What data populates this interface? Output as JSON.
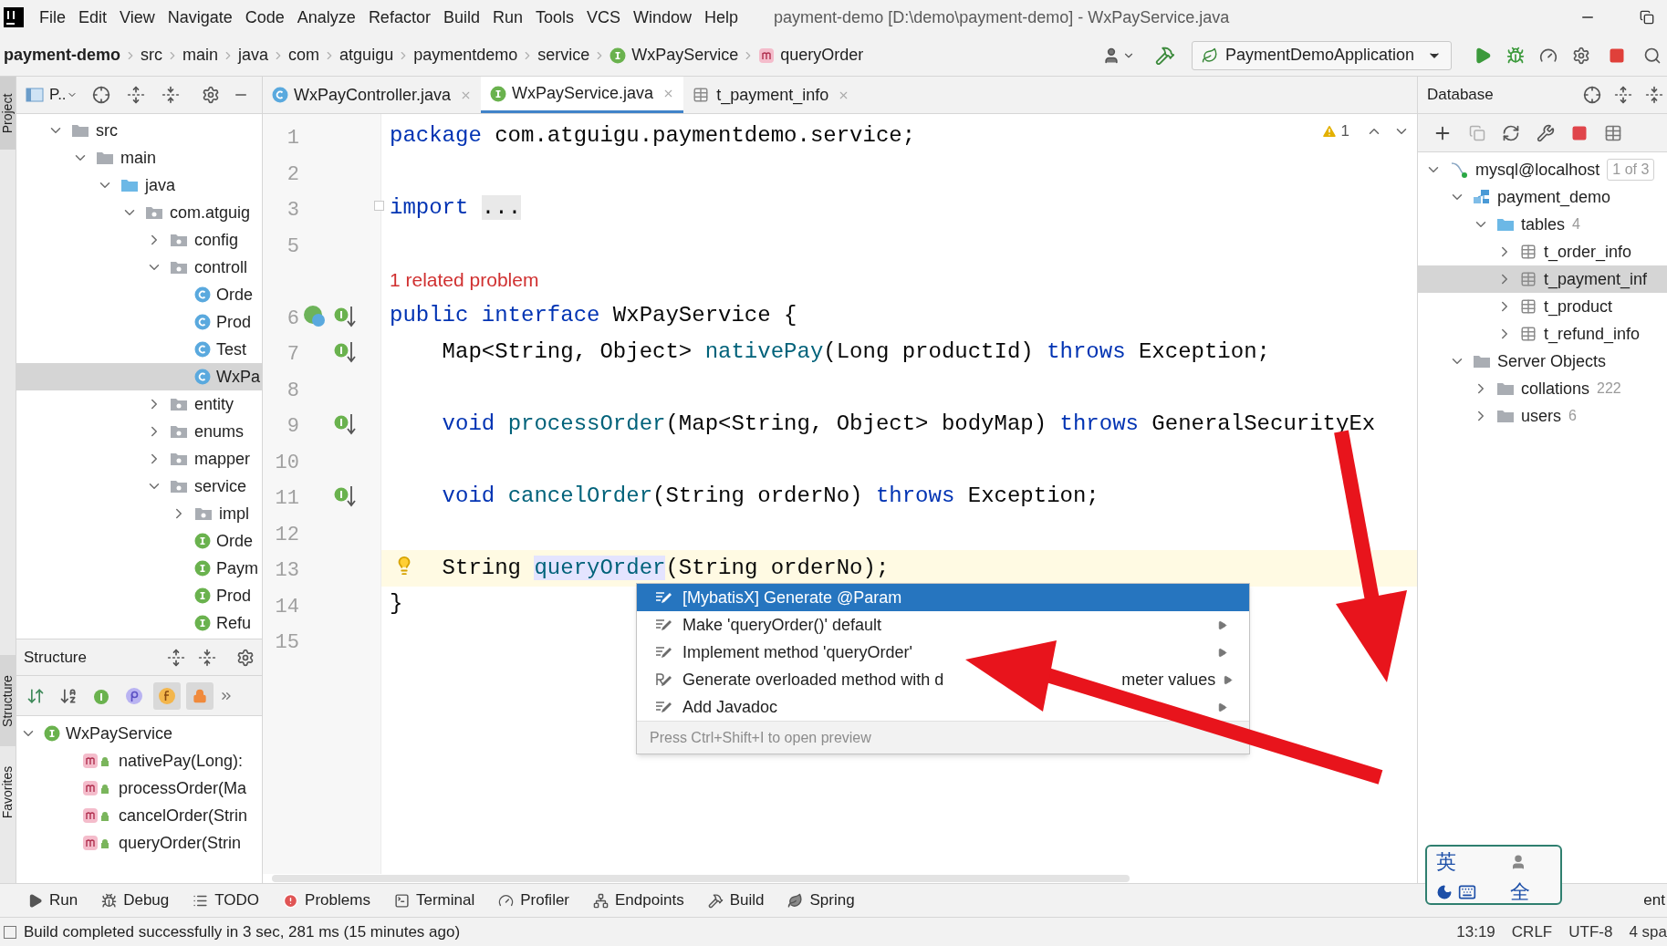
{
  "menu_bar": {
    "items": [
      "File",
      "Edit",
      "View",
      "Navigate",
      "Code",
      "Analyze",
      "Refactor",
      "Build",
      "Run",
      "Tools",
      "VCS",
      "Window",
      "Help"
    ],
    "title": "payment-demo [D:\\demo\\payment-demo] - WxPayService.java"
  },
  "breadcrumbs": [
    {
      "label": "payment-demo",
      "kind": "project"
    },
    {
      "label": "src",
      "kind": "dir"
    },
    {
      "label": "main",
      "kind": "dir"
    },
    {
      "label": "java",
      "kind": "dir"
    },
    {
      "label": "com",
      "kind": "dir"
    },
    {
      "label": "atguigu",
      "kind": "dir"
    },
    {
      "label": "paymentdemo",
      "kind": "dir"
    },
    {
      "label": "service",
      "kind": "dir"
    },
    {
      "label": "WxPayService",
      "kind": "interface"
    },
    {
      "label": "queryOrder",
      "kind": "method"
    }
  ],
  "run_config": "PaymentDemoApplication",
  "side_strip": {
    "top": [
      "Project"
    ],
    "bottom": [
      "Structure",
      "Favorites"
    ]
  },
  "project_panel": {
    "title": "P..",
    "tree": [
      {
        "label": "src",
        "kind": "folder",
        "expanded": true,
        "selected": false,
        "children": [
          {
            "label": "main",
            "kind": "folder",
            "expanded": true,
            "selected": false,
            "children": [
              {
                "label": "java",
                "kind": "source-folder",
                "expanded": true,
                "selected": false,
                "children": [
                  {
                    "label": "com.atguig",
                    "kind": "package",
                    "expanded": true,
                    "selected": false,
                    "children": [
                      {
                        "label": "config",
                        "kind": "package",
                        "expanded": false,
                        "selected": false
                      },
                      {
                        "label": "controll",
                        "kind": "package",
                        "expanded": true,
                        "selected": false,
                        "children": [
                          {
                            "label": "Orde",
                            "kind": "class",
                            "selected": false
                          },
                          {
                            "label": "Prod",
                            "kind": "class",
                            "selected": false
                          },
                          {
                            "label": "Test",
                            "kind": "class",
                            "selected": false
                          },
                          {
                            "label": "WxPa",
                            "kind": "class",
                            "selected": true
                          }
                        ]
                      },
                      {
                        "label": "entity",
                        "kind": "package",
                        "expanded": false,
                        "selected": false
                      },
                      {
                        "label": "enums",
                        "kind": "package",
                        "expanded": false,
                        "selected": false
                      },
                      {
                        "label": "mapper",
                        "kind": "package",
                        "expanded": false,
                        "selected": false
                      },
                      {
                        "label": "service",
                        "kind": "package",
                        "expanded": true,
                        "selected": false,
                        "children": [
                          {
                            "label": "impl",
                            "kind": "package",
                            "expanded": false,
                            "selected": false
                          },
                          {
                            "label": "Orde",
                            "kind": "interface",
                            "selected": false
                          },
                          {
                            "label": "Paym",
                            "kind": "interface",
                            "selected": false
                          },
                          {
                            "label": "Prod",
                            "kind": "interface",
                            "selected": false
                          },
                          {
                            "label": "Refu",
                            "kind": "interface",
                            "selected": false
                          }
                        ]
                      }
                    ]
                  }
                ]
              }
            ]
          }
        ]
      }
    ]
  },
  "structure_panel": {
    "title": "Structure",
    "toggles": [
      {
        "kind": "sort-visibility",
        "on": false
      },
      {
        "kind": "sort-alpha",
        "on": false
      },
      {
        "kind": "inherited",
        "on": false
      },
      {
        "kind": "properties",
        "on": false
      },
      {
        "kind": "fields",
        "on": true
      },
      {
        "kind": "non-public",
        "on": true
      }
    ],
    "tree": [
      {
        "label": "WxPayService",
        "kind": "interface",
        "expanded": true,
        "selected": false,
        "children": [
          {
            "label": "nativePay(Long):",
            "kind": "method",
            "selected": false
          },
          {
            "label": "processOrder(Ma",
            "kind": "method",
            "selected": false
          },
          {
            "label": "cancelOrder(Strin",
            "kind": "method",
            "selected": false
          },
          {
            "label": "queryOrder(Strin",
            "kind": "method",
            "selected": false
          }
        ]
      }
    ]
  },
  "editor_tabs": [
    {
      "label": "WxPayController.java",
      "kind": "class",
      "selected": false
    },
    {
      "label": "WxPayService.java",
      "kind": "interface",
      "selected": true
    },
    {
      "label": "t_payment_info",
      "kind": "table",
      "selected": false
    }
  ],
  "editor": {
    "warnings": "1",
    "lines": [
      {
        "kind": "code",
        "number": "1",
        "current": false,
        "tokens": [
          {
            "t": "package ",
            "kind": "keyword"
          },
          {
            "t": "com.atguigu.paymentdemo.service;",
            "kind": "plain"
          }
        ]
      },
      {
        "kind": "code",
        "number": "2",
        "current": false
      },
      {
        "kind": "folded",
        "number": "3",
        "current": false,
        "tokens": [
          {
            "t": "import ",
            "kind": "keyword"
          },
          {
            "t": "...",
            "kind": "fold"
          }
        ]
      },
      {
        "kind": "code",
        "number": "5",
        "current": false
      },
      {
        "kind": "inlay",
        "text": "1 related problem"
      },
      {
        "kind": "code",
        "number": "6",
        "current": false,
        "gutter": [
          {
            "kind": "spring"
          },
          {
            "kind": "implemented"
          }
        ],
        "tokens": [
          {
            "t": "public interface ",
            "kind": "keyword"
          },
          {
            "t": "WxPayService {",
            "kind": "plain"
          }
        ]
      },
      {
        "kind": "code",
        "number": "7",
        "current": false,
        "gutter": [
          {
            "kind": "implemented"
          }
        ],
        "tokens": [
          {
            "t": "    Map<String, Object> ",
            "kind": "plain"
          },
          {
            "t": "nativePay",
            "kind": "method"
          },
          {
            "t": "(Long productId) ",
            "kind": "plain"
          },
          {
            "t": "throws",
            "kind": "keyword"
          },
          {
            "t": " Exception;",
            "kind": "plain"
          }
        ]
      },
      {
        "kind": "code",
        "number": "8",
        "current": false
      },
      {
        "kind": "code",
        "number": "9",
        "current": false,
        "gutter": [
          {
            "kind": "implemented"
          }
        ],
        "tokens": [
          {
            "t": "    void ",
            "kind": "keyword"
          },
          {
            "t": "processOrder",
            "kind": "method"
          },
          {
            "t": "(Map<String, Object> bodyMap) ",
            "kind": "plain"
          },
          {
            "t": "throws",
            "kind": "keyword"
          },
          {
            "t": " GeneralSecurityEx",
            "kind": "plain"
          }
        ]
      },
      {
        "kind": "code",
        "number": "10",
        "current": false
      },
      {
        "kind": "code",
        "number": "11",
        "current": false,
        "gutter": [
          {
            "kind": "implemented"
          }
        ],
        "tokens": [
          {
            "t": "    void ",
            "kind": "keyword"
          },
          {
            "t": "cancelOrder",
            "kind": "method"
          },
          {
            "t": "(String orderNo) ",
            "kind": "plain"
          },
          {
            "t": "throws",
            "kind": "keyword"
          },
          {
            "t": " Exception;",
            "kind": "plain"
          }
        ]
      },
      {
        "kind": "code",
        "number": "12",
        "current": false
      },
      {
        "kind": "code",
        "number": "13",
        "current": true,
        "marks": [
          {
            "kind": "intention-bulb"
          }
        ],
        "tokens": [
          {
            "t": "    String ",
            "kind": "plain"
          },
          {
            "t": "queryOrder",
            "kind": "method-highlighted"
          },
          {
            "t": "(String orderNo);",
            "kind": "plain"
          }
        ]
      },
      {
        "kind": "code",
        "number": "14",
        "current": false,
        "tokens": [
          {
            "t": "}",
            "kind": "plain"
          }
        ]
      },
      {
        "kind": "code",
        "number": "15",
        "current": false
      }
    ]
  },
  "popup": {
    "items": [
      {
        "label": "[MybatisX] Generate @Param",
        "kind": "intention",
        "selected": true,
        "submenu": false
      },
      {
        "label": "Make 'queryOrder()' default",
        "kind": "intention",
        "selected": false,
        "submenu": true
      },
      {
        "label": "Implement method 'queryOrder'",
        "kind": "intention",
        "selected": false,
        "submenu": true
      },
      {
        "label": "Generate overloaded method with d",
        "label_tail": "meter values",
        "kind": "refactor",
        "selected": false,
        "submenu": true
      },
      {
        "label": "Add Javadoc",
        "kind": "intention",
        "selected": false,
        "submenu": true
      }
    ],
    "footer": "Press Ctrl+Shift+I to open preview"
  },
  "database_panel": {
    "title": "Database",
    "tree": [
      {
        "label": "mysql@localhost",
        "kind": "datasource",
        "badge": "1 of 3",
        "expanded": true,
        "selected": false,
        "children": [
          {
            "label": "payment_demo",
            "kind": "schema",
            "expanded": true,
            "selected": false,
            "children": [
              {
                "label": "tables",
                "kind": "source-folder",
                "count": "4",
                "expanded": true,
                "selected": false,
                "children": [
                  {
                    "label": "t_order_info",
                    "kind": "table",
                    "expanded": false,
                    "selected": false
                  },
                  {
                    "label": "t_payment_inf",
                    "kind": "table",
                    "expanded": false,
                    "selected": true
                  },
                  {
                    "label": "t_product",
                    "kind": "table",
                    "expanded": false,
                    "selected": false
                  },
                  {
                    "label": "t_refund_info",
                    "kind": "table",
                    "expanded": false,
                    "selected": false
                  }
                ]
              }
            ]
          },
          {
            "label": "Server Objects",
            "kind": "folder",
            "expanded": true,
            "selected": false,
            "children": [
              {
                "label": "collations",
                "kind": "folder",
                "count": "222",
                "expanded": false,
                "selected": false
              },
              {
                "label": "users",
                "kind": "folder",
                "count": "6",
                "expanded": false,
                "selected": false
              }
            ]
          }
        ]
      }
    ]
  },
  "tool_windows": [
    {
      "label": "Run",
      "kind": "run"
    },
    {
      "label": "Debug",
      "kind": "debug"
    },
    {
      "label": "TODO",
      "kind": "todo"
    },
    {
      "label": "Problems",
      "kind": "problems"
    },
    {
      "label": "Terminal",
      "kind": "terminal"
    },
    {
      "label": "Profiler",
      "kind": "profiler"
    },
    {
      "label": "Endpoints",
      "kind": "endpoints"
    },
    {
      "label": "Build",
      "kind": "build"
    },
    {
      "label": "Spring",
      "kind": "spring"
    }
  ],
  "tool_windows_right": "ent",
  "status_bar": {
    "message": "Build completed successfully in 3 sec, 281 ms (15 minutes ago)",
    "right": [
      "13:19",
      "CRLF",
      "UTF-8",
      "4 spa"
    ]
  },
  "ime": [
    "英",
    "全"
  ]
}
